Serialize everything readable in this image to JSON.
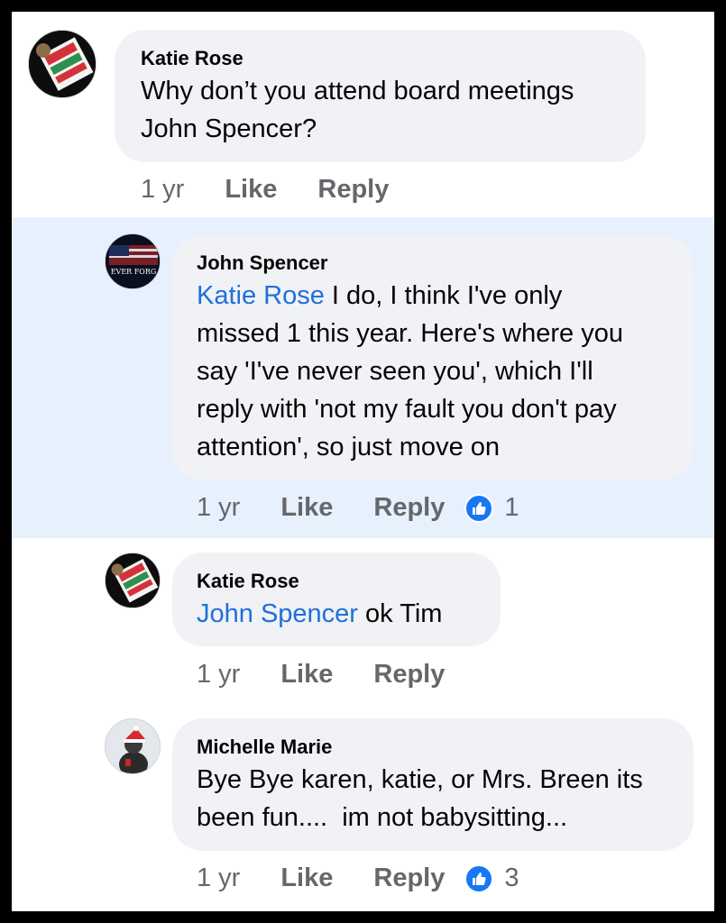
{
  "comments": [
    {
      "author": "Katie Rose",
      "mention": "",
      "text_lines": [
        "Why don’t you attend board meetings",
        "John Spencer?"
      ],
      "time": "1 yr",
      "like": "Like",
      "reply": "Reply",
      "reactions": ""
    },
    {
      "author": "John Spencer",
      "mention": "Katie Rose",
      "text_lines": [
        " I do, I think I've only",
        "missed 1 this year. Here's where you",
        "say 'I've never seen you', which I'll",
        "reply with 'not my fault you don't pay",
        "attention', so just move on"
      ],
      "time": "1 yr",
      "like": "Like",
      "reply": "Reply",
      "reactions": "1",
      "avatar_text": "EVER FORG"
    },
    {
      "author": "Katie Rose",
      "mention": "John Spencer",
      "text_lines": [
        " ok Tim"
      ],
      "time": "1 yr",
      "like": "Like",
      "reply": "Reply",
      "reactions": ""
    },
    {
      "author": "Michelle Marie",
      "mention": "",
      "text_lines": [
        "Bye Bye karen, katie, or Mrs. Breen its",
        "been fun....  im not babysitting..."
      ],
      "time": "1 yr",
      "like": "Like",
      "reply": "Reply",
      "reactions": "3"
    }
  ],
  "colors": {
    "mention": "#216fdb",
    "bubble": "#f0f2f5",
    "highlight": "#e7f0fd",
    "like_badge": "#1877f2"
  },
  "icons": [
    "keep-avatar-icon",
    "flag-avatar-icon",
    "santa-avatar-icon",
    "thumbs-up-icon"
  ]
}
